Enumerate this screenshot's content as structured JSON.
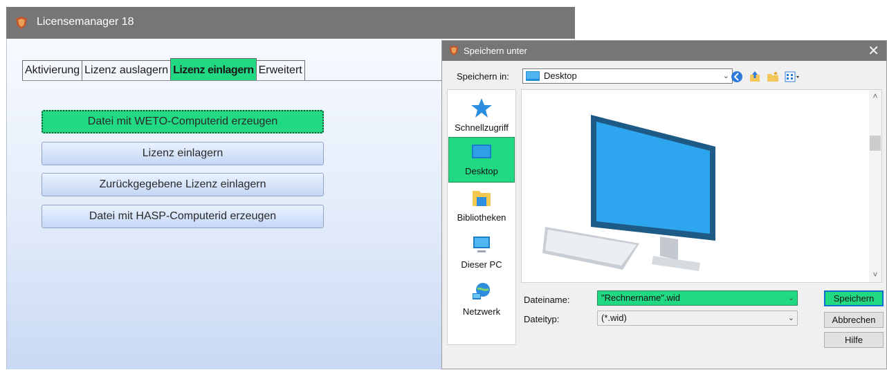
{
  "main_window": {
    "title": "Licensemanager 18",
    "tabs": [
      {
        "label": "Aktivierung",
        "active": false
      },
      {
        "label": "Lizenz auslagern",
        "active": false
      },
      {
        "label": "Lizenz einlagern",
        "active": true
      },
      {
        "label": "Erweitert",
        "active": false
      }
    ],
    "buttons": {
      "create_weto": "Datei mit WETO-Computerid erzeugen",
      "import_license": "Lizenz einlagern",
      "import_returned": "Zurückgegebene Lizenz einlagern",
      "create_hasp": "Datei mit HASP-Computerid erzeugen"
    }
  },
  "save_dialog": {
    "title": "Speichern unter",
    "close_glyph": "✕",
    "save_in_label": "Speichern in:",
    "save_in_value": "Desktop",
    "places": [
      {
        "label": "Schnellzugriff",
        "icon": "star-icon",
        "selected": false
      },
      {
        "label": "Desktop",
        "icon": "desktop-icon",
        "selected": true
      },
      {
        "label": "Bibliotheken",
        "icon": "folder-library-icon",
        "selected": false
      },
      {
        "label": "Dieser PC",
        "icon": "computer-icon",
        "selected": false
      },
      {
        "label": "Netzwerk",
        "icon": "network-icon",
        "selected": false
      }
    ],
    "filename_label": "Dateiname:",
    "filename_value": "\"Rechnername\".wid",
    "filetype_label": "Dateityp:",
    "filetype_value": "(*.wid)",
    "buttons": {
      "save": "Speichern",
      "cancel": "Abbrechen",
      "help": "Hilfe"
    }
  },
  "colors": {
    "accent_green": "#21d982",
    "titlebar": "#767676",
    "panel_blue": "#e2ebfa"
  }
}
